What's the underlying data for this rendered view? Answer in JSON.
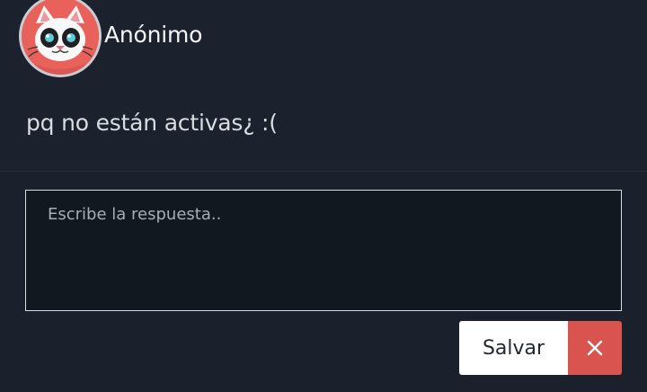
{
  "post": {
    "author": "Anónimo",
    "avatar_icon": "cat-avatar-icon",
    "comment": "pq no están activas¿ :("
  },
  "reply": {
    "placeholder": "Escribe la respuesta..",
    "value": ""
  },
  "actions": {
    "save_label": "Salvar",
    "cancel_icon": "close-icon",
    "colors": {
      "cancel": "#d9534f",
      "save": "#ffffff"
    }
  }
}
